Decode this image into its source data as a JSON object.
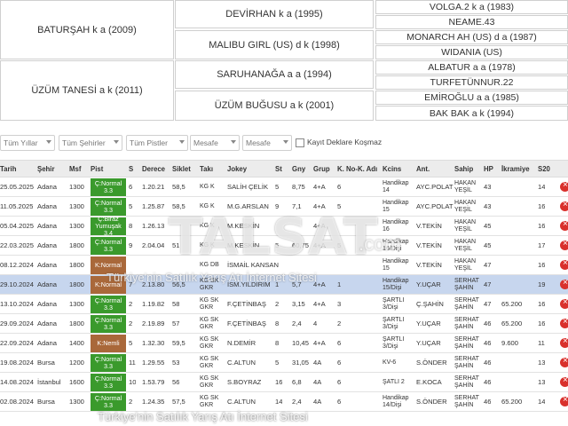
{
  "pedigree": {
    "gen1": [
      "BATURŞAH k a (2009)",
      "ÜZÜM TANESİ a k (2011)"
    ],
    "gen2": [
      "DEVİRHAN k a (1995)",
      "MALIBU GIRL (US) d k (1998)",
      "SARUHANAĞA a a (1994)",
      "ÜZÜM BUĞUSU a k (2001)"
    ],
    "gen3": [
      "VOLGA.2 k a (1983)",
      "NEAME.43",
      "MONARCH AH (US) d a (1987)",
      "WIDANIA (US)",
      "ALBATUR a a (1978)",
      "TURFETÜNNUR.22",
      "EMİROĞLU a a (1985)",
      "BAK BAK a k (1994)"
    ]
  },
  "filters": {
    "years": "Tüm Yıllar",
    "cities": "Tüm Şehirler",
    "tracks": "Tüm Pistler",
    "distance1": "Mesafe",
    "distance2": "Mesafe",
    "checkbox_label": "Kayıt Deklare Koşmaz"
  },
  "table": {
    "headers": [
      "Tarih",
      "Şehir",
      "Msf",
      "Pist",
      "S",
      "Derece",
      "Siklet",
      "Takı",
      "Jokey",
      "St",
      "Gny",
      "Grup",
      "K. No-K. Adı",
      "Kcins",
      "Ant.",
      "Sahip",
      "HP",
      "İkramiye",
      "S20"
    ],
    "rows": [
      {
        "date": "25.05.2025",
        "city": "Adana",
        "dist": "1300",
        "pist": "Ç:Normal 3.3",
        "s": "6",
        "derece": "1.20.21",
        "siklet": "58,5",
        "taki": "KG K",
        "jokey": "SALİH ÇELİK",
        "st": "5",
        "gny": "8,75",
        "grup": "4+A",
        "kno": "6",
        "kcins": "Handikap 14",
        "ant": "AYC.POLAT",
        "sahip": "HAKAN YEŞİL",
        "hp": "43",
        "ikr": "",
        "s20": "14"
      },
      {
        "date": "11.05.2025",
        "city": "Adana",
        "dist": "1300",
        "pist": "Ç:Normal 3.3",
        "s": "5",
        "derece": "1.25.87",
        "siklet": "58,5",
        "taki": "KG K",
        "jokey": "M.G.ARSLAN",
        "st": "9",
        "gny": "7,1",
        "grup": "4+A",
        "kno": "5",
        "kcins": "Handikap 15",
        "ant": "AYC.POLAT",
        "sahip": "HAKAN YEŞİL",
        "hp": "43",
        "ikr": "",
        "s20": "16"
      },
      {
        "date": "05.04.2025",
        "city": "Adana",
        "dist": "1300",
        "pist": "Ç:Biraz Yumuşak 3.4",
        "s": "8",
        "derece": "1.26.13",
        "siklet": "",
        "taki": "KG K",
        "jokey": "M.KESKİN",
        "st": "",
        "gny": "",
        "grup": "4+A",
        "kno": "",
        "kcins": "Handikap 16",
        "ant": "V.TEKİN",
        "sahip": "HAKAN YEŞİL",
        "hp": "45",
        "ikr": "",
        "s20": "16"
      },
      {
        "date": "22.03.2025",
        "city": "Adana",
        "dist": "1800",
        "pist": "Ç:Normal 3.3",
        "s": "9",
        "derece": "2.04.04",
        "siklet": "51",
        "taki": "KG K",
        "jokey": "M.KESKİN",
        "st": "5",
        "gny": "60,75",
        "grup": "4+A",
        "kno": "5",
        "kcins": "Handikap 16/Dişi",
        "ant": "V.TEKİN",
        "sahip": "HAKAN YEŞİL",
        "hp": "45",
        "ikr": "",
        "s20": "17"
      },
      {
        "date": "08.12.2024",
        "city": "Adana",
        "dist": "1800",
        "pist": "K:Normal",
        "s": "",
        "derece": "",
        "siklet": "",
        "taki": "KG DB",
        "jokey": "İSMAİL KANSAN",
        "st": "",
        "gny": "",
        "grup": "",
        "kno": "",
        "kcins": "Handikap 15",
        "ant": "V.TEKİN",
        "sahip": "HAKAN YEŞİL",
        "hp": "47",
        "ikr": "",
        "s20": "16"
      },
      {
        "date": "29.10.2024",
        "city": "Adana",
        "dist": "1800",
        "pist": "K:Normal",
        "s": "7",
        "derece": "2.13.80",
        "siklet": "56,5",
        "taki": "KG SK GKR",
        "jokey": "İSM.YILDIRIM",
        "st": "1",
        "gny": "5,7",
        "grup": "4+A",
        "kno": "1",
        "kcins": "Handikap 15/Dişi",
        "ant": "Y.UÇAR",
        "sahip": "SERHAT ŞAHİN",
        "hp": "47",
        "ikr": "",
        "s20": "19",
        "highlight": true
      },
      {
        "date": "13.10.2024",
        "city": "Adana",
        "dist": "1300",
        "pist": "Ç:Normal 3.3",
        "s": "2",
        "derece": "1.19.82",
        "siklet": "58",
        "taki": "KG SK GKR",
        "jokey": "F.ÇETİNBAŞ",
        "st": "2",
        "gny": "3,15",
        "grup": "4+A",
        "kno": "3",
        "kcins": "ŞARTLI 3/Dişi",
        "ant": "Ç.ŞAHİN",
        "sahip": "SERHAT ŞAHİN",
        "hp": "47",
        "ikr": "65.200",
        "s20": "16"
      },
      {
        "date": "29.09.2024",
        "city": "Adana",
        "dist": "1800",
        "pist": "Ç:Normal 3.3",
        "s": "2",
        "derece": "2.19.89",
        "siklet": "57",
        "taki": "KG SK GKR",
        "jokey": "F.ÇETİNBAŞ",
        "st": "8",
        "gny": "2,4",
        "grup": "4",
        "kno": "2",
        "kcins": "ŞARTLI 3/Dişi",
        "ant": "Y.UÇAR",
        "sahip": "SERHAT ŞAHİN",
        "hp": "46",
        "ikr": "65.200",
        "s20": "16"
      },
      {
        "date": "22.09.2024",
        "city": "Adana",
        "dist": "1400",
        "pist": "K:Nemli",
        "s": "5",
        "derece": "1.32.30",
        "siklet": "59,5",
        "taki": "KG SK GKR",
        "jokey": "N.DEMİR",
        "st": "8",
        "gny": "10,45",
        "grup": "4+A",
        "kno": "6",
        "kcins": "ŞARTLI 3/Dişi",
        "ant": "Y.UÇAR",
        "sahip": "SERHAT ŞAHİN",
        "hp": "46",
        "ikr": "9.600",
        "s20": "11"
      },
      {
        "date": "19.08.2024",
        "city": "Bursa",
        "dist": "1200",
        "pist": "Ç:Normal 3.3",
        "s": "11",
        "derece": "1.29.55",
        "siklet": "53",
        "taki": "KG SK GKR",
        "jokey": "C.ALTUN",
        "st": "5",
        "gny": "31,05",
        "grup": "4A",
        "kno": "6",
        "kcins": "KV-6",
        "ant": "S.ÖNDER",
        "sahip": "SERHAT ŞAHİN",
        "hp": "46",
        "ikr": "",
        "s20": "13"
      },
      {
        "date": "14.08.2024",
        "city": "İstanbul",
        "dist": "1600",
        "pist": "Ç:Normal 3.3",
        "s": "10",
        "derece": "1.53.79",
        "siklet": "56",
        "taki": "KG SK GKR",
        "jokey": "S.BOYRAZ",
        "st": "16",
        "gny": "6,8",
        "grup": "4A",
        "kno": "6",
        "kcins": "ŞATLI 2",
        "ant": "E.KOCA",
        "sahip": "SERHAT ŞAHİN",
        "hp": "46",
        "ikr": "",
        "s20": "13"
      },
      {
        "date": "02.08.2024",
        "city": "Bursa",
        "dist": "1300",
        "pist": "Ç:Normal 3.3",
        "s": "2",
        "derece": "1.24.35",
        "siklet": "57,5",
        "taki": "KG SK GKR",
        "jokey": "C.ALTUN",
        "st": "14",
        "gny": "2,4",
        "grup": "4A",
        "kno": "6",
        "kcins": "Handikap 14/Dişi",
        "ant": "S.ÖNDER",
        "sahip": "SERHAT ŞAHİN",
        "hp": "46",
        "ikr": "65.200",
        "s20": "14"
      }
    ]
  },
  "watermark": {
    "logo": "TALSAT",
    "domain": ".com",
    "tagline": "Türkiye'nin Satılık Yarış Atı İnternet Sitesi"
  },
  "colors": {
    "pist_green": "#3a9a2c",
    "pist_brown": "#a9683a",
    "highlight_row": "#c7d6ee",
    "delete_red": "#d9302c"
  },
  "icons": [
    "dropdown-caret-icon",
    "checkbox-icon",
    "delete-icon"
  ]
}
